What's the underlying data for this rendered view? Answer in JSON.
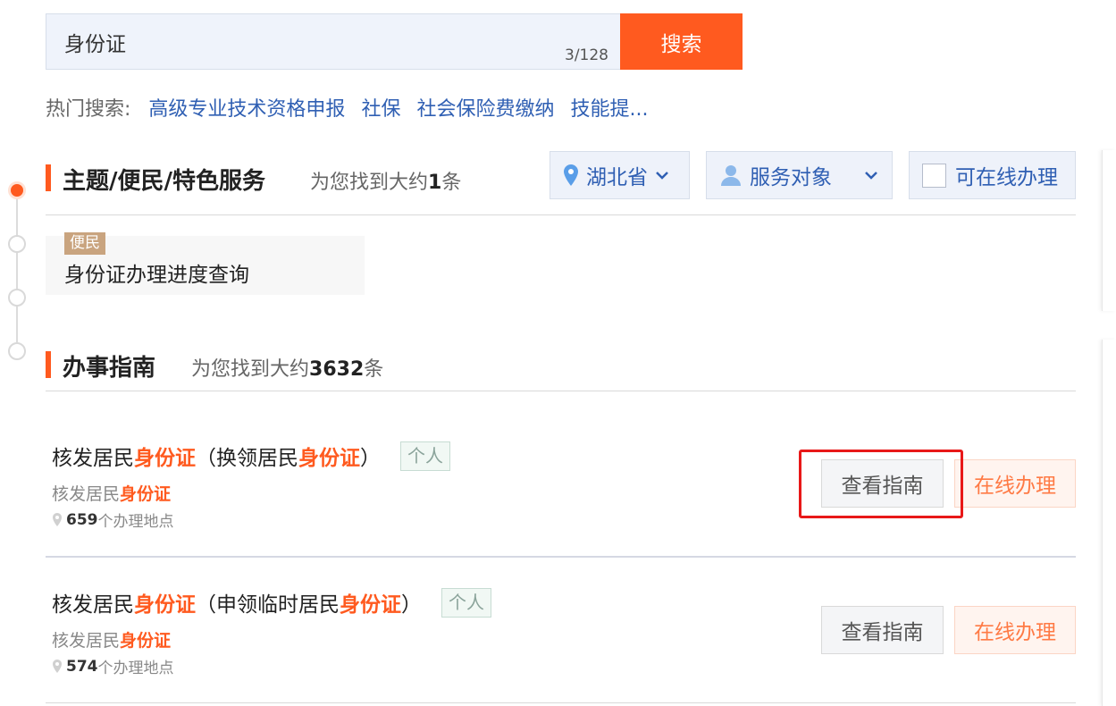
{
  "search": {
    "value": "身份证",
    "counter": "3/128",
    "button_label": "搜索"
  },
  "hot_search": {
    "label": "热门搜索:",
    "items": [
      "高级专业技术资格申报",
      "社保",
      "社会保险费缴纳",
      "技能提..."
    ]
  },
  "section_topics": {
    "title": "主题/便民/特色服务",
    "count_prefix": "为您找到大约",
    "count": "1",
    "count_suffix": "条",
    "filters": {
      "location": "湖北省",
      "audience": "服务对象",
      "online": "可在线办理"
    },
    "results": [
      {
        "tag": "便民",
        "title": "身份证办理进度查询"
      }
    ]
  },
  "section_guides": {
    "title": "办事指南",
    "count_prefix": "为您找到大约",
    "count": "3632",
    "count_suffix": "条",
    "items": [
      {
        "title_parts": [
          "核发居民",
          "身份证",
          "（换领居民",
          "身份证",
          "）"
        ],
        "tag": "个人",
        "sub_parts": [
          "核发居民",
          "身份证"
        ],
        "locations": "659",
        "locations_suffix": "个办理地点",
        "guide_label": "查看指南",
        "online_label": "在线办理"
      },
      {
        "title_parts": [
          "核发居民",
          "身份证",
          "（申领临时居民",
          "身份证",
          "）"
        ],
        "tag": "个人",
        "sub_parts": [
          "核发居民",
          "身份证"
        ],
        "locations": "574",
        "locations_suffix": "个办理地点",
        "guide_label": "查看指南",
        "online_label": "在线办理"
      }
    ]
  },
  "colors": {
    "accent": "#ff5a1f",
    "link": "#2f5fb3",
    "highlight_box": "#e81818"
  }
}
